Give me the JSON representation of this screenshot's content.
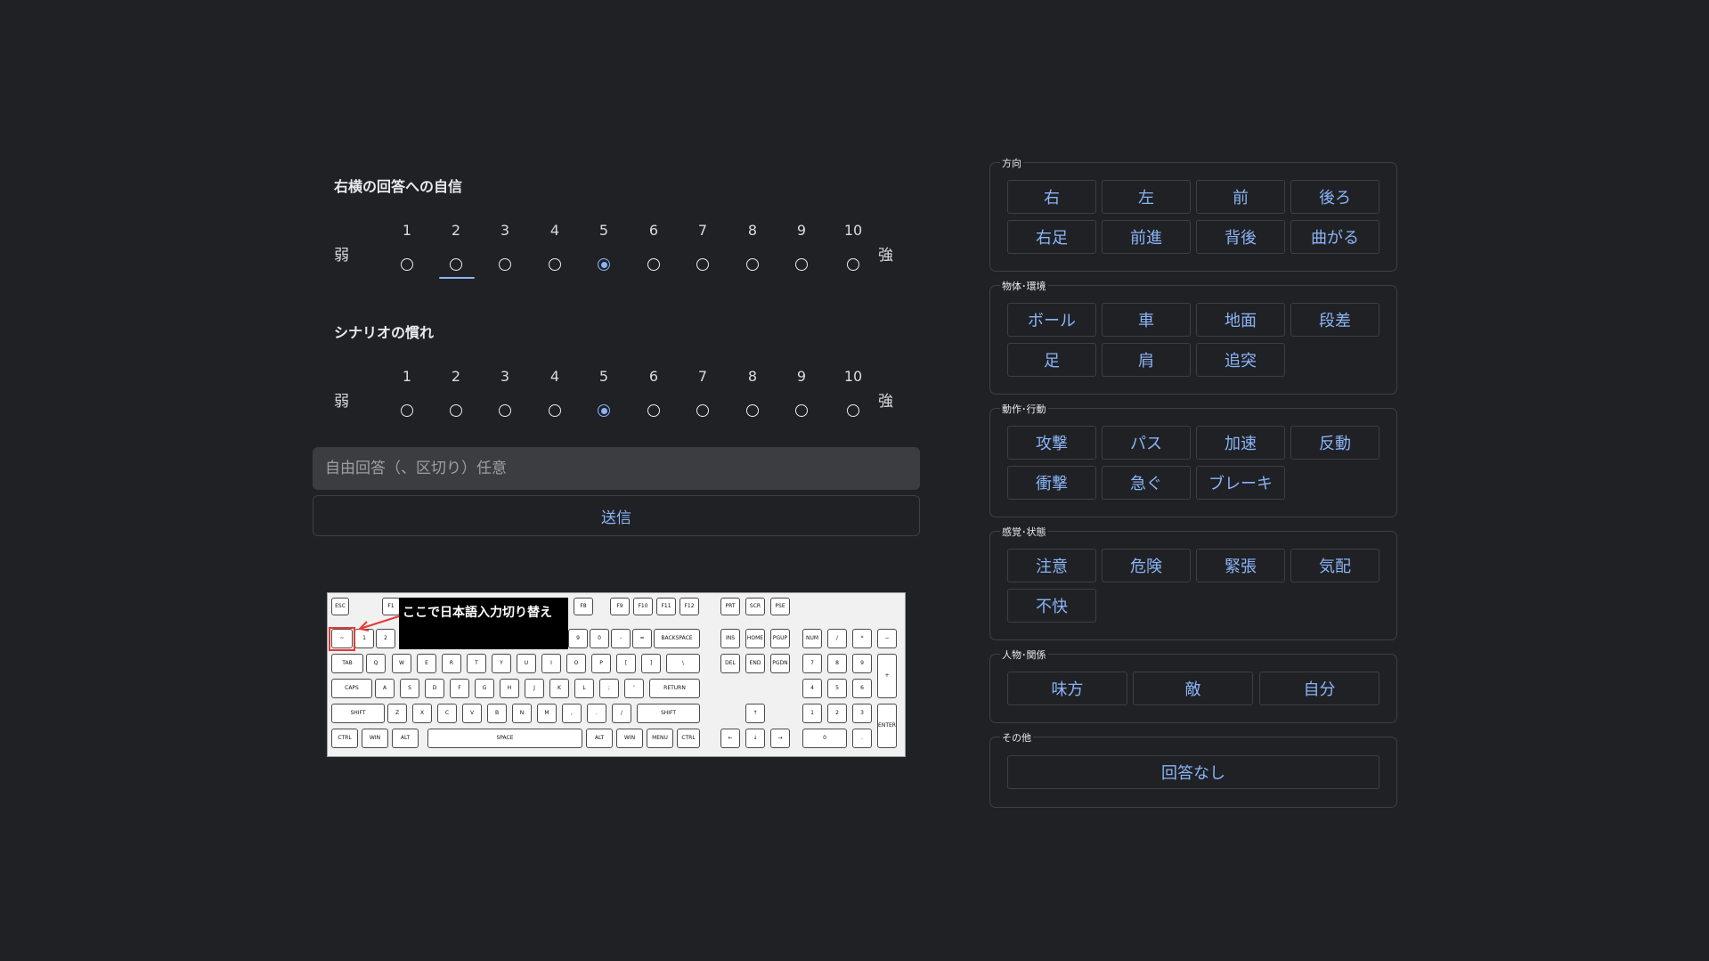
{
  "confidence": {
    "title": "右横の回答への自信",
    "weak": "弱",
    "strong": "強",
    "options": [
      "1",
      "2",
      "3",
      "4",
      "5",
      "6",
      "7",
      "8",
      "9",
      "10"
    ],
    "selected": 5
  },
  "familiarity": {
    "title": "シナリオの慣れ",
    "weak": "弱",
    "strong": "強",
    "options": [
      "1",
      "2",
      "3",
      "4",
      "5",
      "6",
      "7",
      "8",
      "9",
      "10"
    ],
    "selected": 5
  },
  "free_answer": {
    "placeholder": "自由回答（、区切り）任意",
    "value": ""
  },
  "submit": {
    "label": "送信"
  },
  "keyboard_note": {
    "text": "ここで日本語入力切り替え"
  },
  "tag_groups": [
    {
      "title": "方向",
      "tags": [
        "右",
        "左",
        "前",
        "後ろ",
        "右足",
        "前進",
        "背後",
        "曲がる"
      ]
    },
    {
      "title": "物体･環境",
      "tags": [
        "ボール",
        "車",
        "地面",
        "段差",
        "足",
        "肩",
        "追突"
      ]
    },
    {
      "title": "動作･行動",
      "tags": [
        "攻撃",
        "パス",
        "加速",
        "反動",
        "衝撃",
        "急ぐ",
        "ブレーキ"
      ]
    },
    {
      "title": "感覚･状態",
      "tags": [
        "注意",
        "危険",
        "緊張",
        "気配",
        "不快"
      ]
    },
    {
      "title": "人物･関係",
      "tags": [
        "味方",
        "敵",
        "自分"
      ]
    },
    {
      "title": "その他",
      "tags": [
        "回答なし"
      ]
    }
  ],
  "colors": {
    "background": "#202124",
    "accent": "#8ab4f8",
    "input_bg": "#3c3d40",
    "border": "#3c4043"
  }
}
